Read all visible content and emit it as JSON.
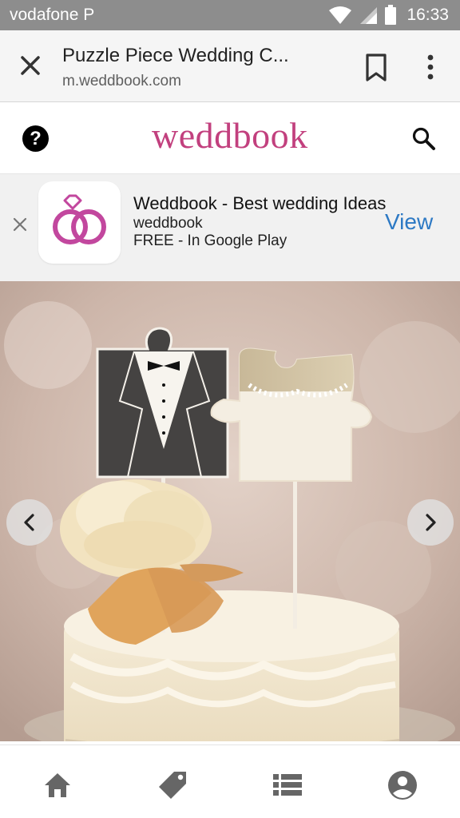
{
  "status_bar": {
    "carrier": "vodafone P",
    "time": "16:33"
  },
  "tab_bar": {
    "title": "Puzzle Piece Wedding C...",
    "url": "m.weddbook.com"
  },
  "site_header": {
    "logo_text": "weddbook"
  },
  "app_banner": {
    "app_name": "Weddbook - Best wedding Ideas",
    "developer": "weddbook",
    "price_note": "FREE - In Google Play",
    "action_label": "View"
  },
  "icons": {
    "close": "close-icon",
    "bookmark": "bookmark-icon",
    "more": "more-vert-icon",
    "help": "help-icon",
    "search": "search-icon",
    "prev": "chevron-left-icon",
    "next": "chevron-right-icon",
    "home": "home-icon",
    "tag": "tag-icon",
    "list": "list-icon",
    "account": "account-icon"
  },
  "colors": {
    "brand": "#c2407e",
    "link": "#2d79c4",
    "status_bar": "#8d8d8d"
  }
}
